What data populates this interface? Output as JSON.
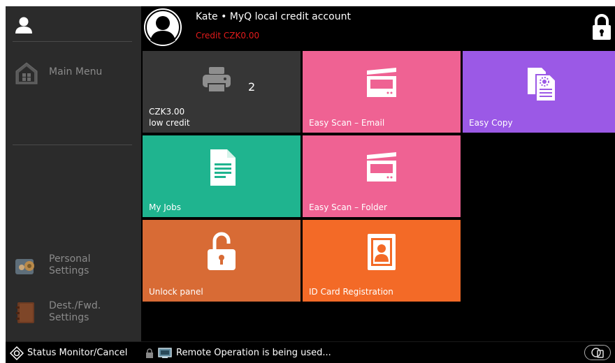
{
  "header": {
    "account_name": "Kate • MyQ local credit account",
    "credit": "Credit CZK0.00"
  },
  "sidebar": {
    "main_menu": "Main Menu",
    "personal_settings": "Personal\nSettings",
    "dest_settings": "Dest./Fwd.\nSettings"
  },
  "tiles": {
    "print": {
      "count": "2",
      "label": "CZK3.00\nlow credit"
    },
    "scan_email": {
      "label": "Easy Scan – Email"
    },
    "copy": {
      "label": "Easy Copy"
    },
    "my_jobs": {
      "label": "My Jobs"
    },
    "scan_folder": {
      "label": "Easy Scan – Folder"
    },
    "unlock": {
      "label": "Unlock panel"
    },
    "id_card": {
      "label": "ID Card Registration"
    }
  },
  "bottom": {
    "status_label": "Status Monitor/Cancel",
    "remote_message": "Remote Operation is being used..."
  },
  "colors": {
    "print_tile": "#363636",
    "scan_tile": "#ef6293",
    "copy_tile": "#9b59e6",
    "jobs_tile": "#1fb48f",
    "unlock_tile": "#d86b35",
    "idcard_tile": "#f36a27",
    "credit_text": "#e31b1b"
  },
  "icons": [
    "user-icon",
    "home-icon",
    "personal-settings-icon",
    "address-book-icon",
    "lock-icon",
    "printer-icon",
    "scanner-icon",
    "copy-icon",
    "document-icon",
    "unlocked-padlock-icon",
    "id-card-icon",
    "status-monitor-icon",
    "remote-operation-icon"
  ]
}
